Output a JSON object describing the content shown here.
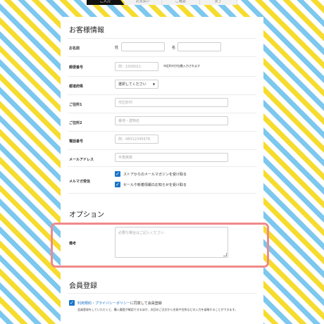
{
  "steps": [
    "ご入力",
    "お支払い",
    "ご確認",
    "完了"
  ],
  "sections": {
    "customer": "お客様情報",
    "options": "オプション",
    "member": "会員登録"
  },
  "name": {
    "label": "お名前",
    "last_label": "姓",
    "first_label": "名"
  },
  "zip": {
    "label": "郵便番号",
    "placeholder": "例：1500011",
    "hint": "市区町村が自動入力されます"
  },
  "prefecture": {
    "label": "都道府県",
    "value": "選択してください"
  },
  "address1": {
    "label": "ご住所1",
    "placeholder": "市区町村"
  },
  "address2": {
    "label": "ご住所2",
    "placeholder": "番地・建物名"
  },
  "phone": {
    "label": "電話番号",
    "placeholder": "例：08012345678"
  },
  "email": {
    "label": "メールアドレス",
    "placeholder": "半角英数"
  },
  "newsletter": {
    "label": "メルマガ受信",
    "options": [
      "ストアからのメールマガジンを受け取る",
      "セールや新着情報のお知らせを受け取る"
    ]
  },
  "remarks": {
    "label": "備考",
    "placeholder": "必要な場合はご記入ください"
  },
  "membership": {
    "terms_link": "利用規約・プライバシーポリシー",
    "agree_text": "に同意して会員登録",
    "note": "会員登録をしていただくと、購入履歴が確認できるほか、次回のご注文から名前や住所などの入力を省略することができます。"
  }
}
